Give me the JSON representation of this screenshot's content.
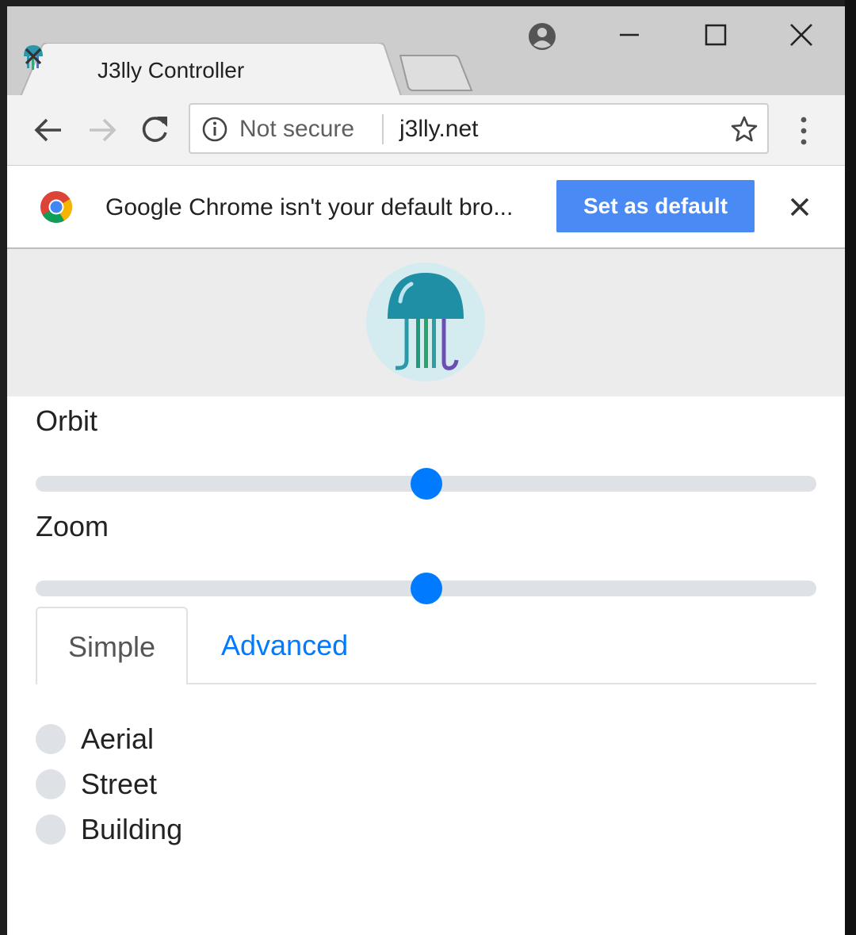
{
  "browser": {
    "tab_title": "J3lly Controller",
    "omnibox": {
      "security_text": "Not secure",
      "url": "j3lly.net"
    }
  },
  "infobar": {
    "message": "Google Chrome isn't your default bro...",
    "button_label": "Set as default"
  },
  "controls": {
    "orbit": {
      "label": "Orbit",
      "value_fraction": 0.5
    },
    "zoom": {
      "label": "Zoom",
      "value_fraction": 0.5
    }
  },
  "tabs": [
    {
      "label": "Simple",
      "active": true
    },
    {
      "label": "Advanced",
      "active": false
    }
  ],
  "view_options": [
    {
      "label": "Aerial",
      "checked": false
    },
    {
      "label": "Street",
      "checked": false
    },
    {
      "label": "Building",
      "checked": false
    }
  ],
  "colors": {
    "accent": "#007bff",
    "infobar_button": "#4a8af4",
    "logo_teal": "#1e8fa4",
    "logo_bg": "#d4ecf0"
  },
  "icons": [
    "jellyfish-favicon-icon",
    "close-icon",
    "profile-icon",
    "minimize-icon",
    "maximize-icon",
    "back-icon",
    "forward-icon",
    "reload-icon",
    "info-icon",
    "star-icon",
    "kebab-menu-icon",
    "chrome-logo-icon",
    "jellyfish-logo-icon"
  ]
}
